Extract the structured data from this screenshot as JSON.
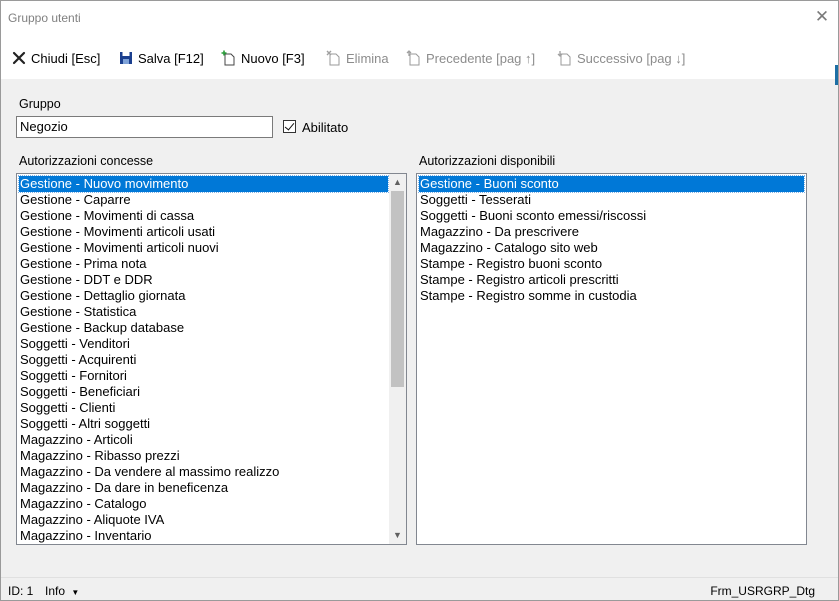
{
  "window": {
    "title": "Gruppo utenti"
  },
  "toolbar": {
    "close_label": "Chiudi [Esc]",
    "save_label": "Salva [F12]",
    "new_label": "Nuovo [F3]",
    "delete_label": "Elimina",
    "prev_label": "Precedente [pag ↑]",
    "next_label": "Successivo [pag ↓]"
  },
  "form": {
    "group_label": "Gruppo",
    "group_value": "Negozio",
    "enabled_label": "Abilitato",
    "enabled_checked": true
  },
  "granted": {
    "label": "Autorizzazioni concesse",
    "items": [
      "Gestione - Nuovo movimento",
      "Gestione - Caparre",
      "Gestione - Movimenti di cassa",
      "Gestione - Movimenti articoli usati",
      "Gestione - Movimenti articoli nuovi",
      "Gestione - Prima nota",
      "Gestione - DDT e DDR",
      "Gestione - Dettaglio giornata",
      "Gestione - Statistica",
      "Gestione - Backup database",
      "Soggetti - Venditori",
      "Soggetti - Acquirenti",
      "Soggetti - Fornitori",
      "Soggetti - Beneficiari",
      "Soggetti - Clienti",
      "Soggetti - Altri soggetti",
      "Magazzino - Articoli",
      "Magazzino - Ribasso prezzi",
      "Magazzino - Da vendere al massimo realizzo",
      "Magazzino - Da dare in beneficenza",
      "Magazzino - Catalogo",
      "Magazzino - Aliquote IVA",
      "Magazzino - Inventario"
    ]
  },
  "available": {
    "label": "Autorizzazioni disponibili",
    "items": [
      "Gestione - Buoni sconto",
      "Soggetti - Tesserati",
      "Soggetti - Buoni sconto emessi/riscossi",
      "Magazzino - Da prescrivere",
      "Magazzino - Catalogo sito web",
      "Stampe - Registro buoni sconto",
      "Stampe - Registro articoli prescritti",
      "Stampe - Registro somme in custodia"
    ]
  },
  "status": {
    "id_text": "ID: 1",
    "info_label": "Info",
    "form_name": "Frm_USRGRP_Dtg"
  },
  "icons": {
    "close": "close-x-icon",
    "save": "floppy-disk-icon",
    "new": "new-document-icon",
    "delete": "delete-document-icon",
    "prev": "previous-document-icon",
    "next": "next-document-icon"
  },
  "colors": {
    "selection": "#0078d7",
    "accent": "#1d6fa5"
  }
}
